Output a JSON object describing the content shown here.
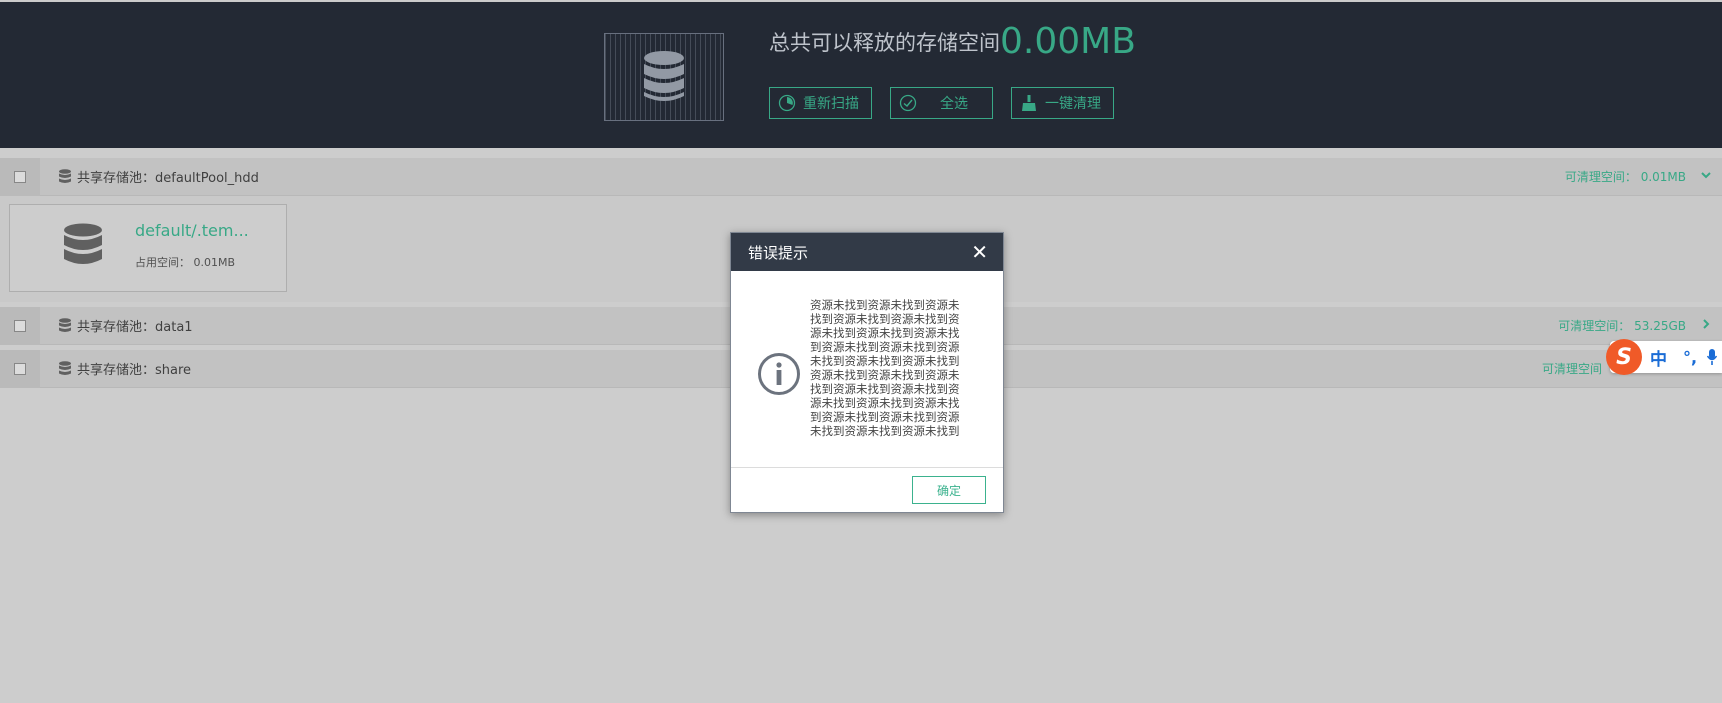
{
  "header": {
    "title": "总共可以释放的存储空间",
    "total_size": "0.00MB",
    "buttons": {
      "rescan": "重新扫描",
      "select_all": "全选",
      "one_click_clean": "一键清理"
    }
  },
  "pools": [
    {
      "label": "共享存储池：defaultPool_hdd",
      "cleanable": "可清理空间： 0.01MB",
      "expanded": true,
      "items": [
        {
          "name": "default/.tem...",
          "usage": "占用空间： 0.01MB"
        }
      ]
    },
    {
      "label": "共享存储池：data1",
      "cleanable": "可清理空间： 53.25GB",
      "expanded": false
    },
    {
      "label": "共享存储池：share",
      "cleanable": "可清理空间",
      "expanded": false
    }
  ],
  "dialog": {
    "title": "错误提示",
    "close": "✕",
    "message": "资源未找到资源未找到资源未找到资源未找到资源未找到资源未找到资源未找到资源未找到资源未找到资源未找到资源未找到资源未找到资源未找到资源未找到资源未找到资源未找到资源未找到资源未找到资源未找到资源未找到资源未找到资源未找到资源未找到资源未找到资源未找到资源未找到",
    "ok": "确定"
  },
  "ime": {
    "logo": "S",
    "lang": "中",
    "punct": "°,"
  },
  "colors": {
    "accent": "#3bb28e",
    "header_bg": "#252c37",
    "dialog_head_bg": "#323a47"
  }
}
